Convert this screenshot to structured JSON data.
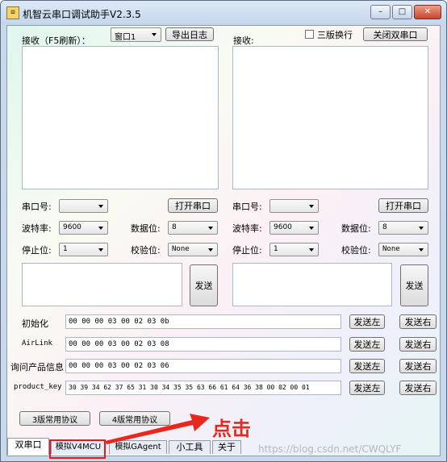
{
  "window": {
    "title": "机智云串口调试助手V2.3.5",
    "app_icon": "≡",
    "minimize": "–",
    "maximize": "□",
    "close": "✕"
  },
  "left": {
    "receive_label": "接收（F5刷新）：",
    "window_select": "窗口1",
    "export_log": "导出日志",
    "port_label": "串口号:",
    "port_value": "",
    "open_port": "打开串口",
    "baud_label": "波特率:",
    "baud_value": "9600",
    "databits_label": "数据位:",
    "databits_value": "8",
    "stopbits_label": "停止位:",
    "stopbits_value": "1",
    "parity_label": "校验位:",
    "parity_value": "None",
    "send": "发送"
  },
  "right": {
    "receive_label": "接收:",
    "three_version_label": "三版换行",
    "close_dual": "关闭双串口",
    "port_label": "串口号:",
    "port_value": "",
    "open_port": "打开串口",
    "baud_label": "波特率:",
    "baud_value": "9600",
    "databits_label": "数据位:",
    "databits_value": "8",
    "stopbits_label": "停止位:",
    "stopbits_value": "1",
    "parity_label": "校验位:",
    "parity_value": "None",
    "send": "发送"
  },
  "commands": [
    {
      "label": "初始化",
      "value": "00 00 00 03 00 02 03 0b",
      "send_left": "发送左",
      "send_right": "发送右"
    },
    {
      "label": "AirLink",
      "value": "00 00 00 03 00 02 03 08",
      "send_left": "发送左",
      "send_right": "发送右"
    },
    {
      "label": "询问产品信息",
      "value": "00 00 00 03 00 02 03 06",
      "send_left": "发送左",
      "send_right": "发送右"
    },
    {
      "label": "product_key",
      "value": "30 39 34 62 37 65 31 30 34 35 35 63 66 61 64 36 38 00 02 00 01",
      "send_left": "发送左",
      "send_right": "发送右"
    }
  ],
  "protocol": {
    "v3": "3版常用协议",
    "v4": "4版常用协议"
  },
  "tabs": [
    "双串口",
    "模拟V4MCU",
    "模拟GAgent",
    "小工具",
    "关于"
  ],
  "annotation": {
    "text": "点击",
    "color": "#e8281f"
  },
  "watermark": "https://blog.csdn.net/CWQLYF"
}
